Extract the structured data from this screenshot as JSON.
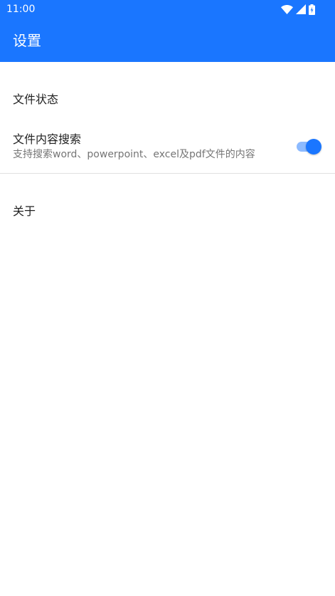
{
  "status_bar": {
    "time": "11:00",
    "icons": [
      "wifi-icon",
      "cellular-signal-icon",
      "battery-charging-icon"
    ]
  },
  "app_bar": {
    "title": "设置",
    "color": "#1a76ff"
  },
  "settings": {
    "category_file_status": "文件状态",
    "content_search": {
      "title": "文件内容搜索",
      "summary": "支持搜索word、powerpoint、excel及pdf文件的内容",
      "enabled": true,
      "accent": "#1a76ff"
    },
    "category_about": "关于"
  }
}
